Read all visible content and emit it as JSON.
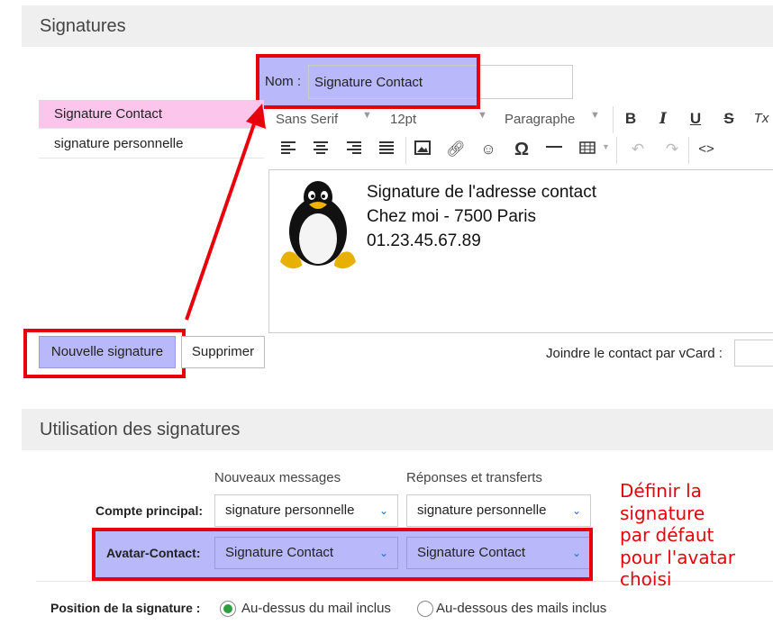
{
  "signatures_section": {
    "title": "Signatures"
  },
  "name_field": {
    "label": "Nom :",
    "value": "Signature Contact"
  },
  "signature_list": [
    {
      "label": "Signature Contact",
      "selected": true
    },
    {
      "label": "signature personnelle",
      "selected": false
    }
  ],
  "toolbar": {
    "font_family": "Sans Serif",
    "font_size": "12pt",
    "block_format": "Paragraphe",
    "bold": "B",
    "italic": "I",
    "underline": "U",
    "strike": "S",
    "clear": "Tx"
  },
  "editor": {
    "lines": [
      "Signature de l'adresse contact",
      "Chez moi - 7500 Paris",
      "01.23.45.67.89"
    ]
  },
  "buttons": {
    "new": "Nouvelle signature",
    "delete": "Supprimer"
  },
  "vcard": {
    "label": "Joindre le contact par vCard :"
  },
  "usage_section": {
    "title": "Utilisation des signatures",
    "col_new": "Nouveaux messages",
    "col_reply": "Réponses et transferts",
    "rows": [
      {
        "label": "Compte principal:",
        "new_value": "signature personnelle",
        "reply_value": "signature personnelle"
      },
      {
        "label": "Avatar-Contact:",
        "new_value": "Signature Contact",
        "reply_value": "Signature Contact"
      }
    ]
  },
  "annotation": {
    "lines": [
      "Définir la",
      "signature",
      "par défaut",
      "pour l'avatar",
      "choisi"
    ]
  },
  "position": {
    "label": "Position de la signature :",
    "above": "Au-dessus du mail inclus",
    "below": "Au-dessous des mails inclus",
    "selected": "above"
  },
  "colors": {
    "highlight": "#b8b8fb",
    "selected_item": "#fbc5ec",
    "red": "#e8000b",
    "link_blue": "#1a6ecc"
  }
}
